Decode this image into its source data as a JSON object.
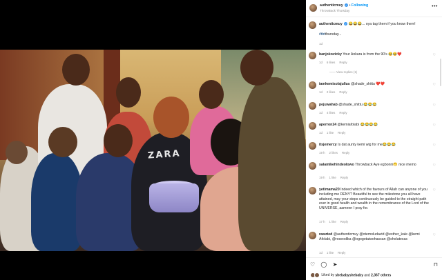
{
  "post": {
    "username": "authenticmuy",
    "follow_label": "Following",
    "subtitle": "ThrowBack Thursday",
    "caption_user": "authenticmuy",
    "caption_text": "😂😂😂... oya tag them if you know them!",
    "caption_tag": "#tbt",
    "caption_tag2": "thursday...",
    "caption_age": "1d",
    "shirt_text": "ZARA"
  },
  "comments": [
    {
      "user": "banjokovicky",
      "text": "Your Ankara is from the 90's 😂😂❤️",
      "age": "1d",
      "likes": "6 likes",
      "reply": "Reply",
      "view_replies": "View replies (1)"
    },
    {
      "user": "iamkemisolajulius",
      "text": "@shade_shittu ❤️❤️",
      "age": "1d",
      "likes": "2 likes",
      "reply": "Reply"
    },
    {
      "user": "pejuwahab",
      "text": "@shade_shittu 😂😂😂",
      "age": "1d",
      "likes": "4 likes",
      "reply": "Reply"
    },
    {
      "user": "aperron24",
      "text": "@kemiafolabi 😂😂😂😂",
      "age": "1d",
      "likes": "1 like",
      "reply": "Reply"
    },
    {
      "user": "itsjemercy",
      "text": "Is dat aunty kemi wig for me😂😂😂",
      "age": "19 h",
      "likes": "2 likes",
      "reply": "Reply"
    },
    {
      "user": "salamikehindeolowo",
      "text": "Throwback Aye egbonni😁 nice memo",
      "age": "19 h",
      "likes": "1 like",
      "reply": "Reply"
    },
    {
      "user": "yetimama20",
      "text": "Indeed which of the favours of Allah can anyone of you including me DENY? Beautiful to see the milestone you all have attained, may your steps continuously be guided to the straight path ever in good health and wealth in the remembrance of the Lord of the UNIVERSE, aameen I pray for.",
      "age": "17 h",
      "likes": "1 like",
      "reply": "Reply"
    },
    {
      "user": "rawzted",
      "text": "@authenticmuy @otemoludavid @esther_kale @kemi Afolabi, @roseodika @ogogotaiwohassan @sholatexas",
      "age": "1d",
      "likes": "1 like",
      "reply": "Reply"
    }
  ],
  "footer": {
    "liked_by_prefix": "Liked by ",
    "liked_by_user": "shebabyshebaby",
    "liked_by_and": " and ",
    "liked_by_count": "2,367 others"
  },
  "icons": [
    "heart-icon",
    "comment-icon",
    "share-icon",
    "bookmark-icon",
    "more-icon"
  ]
}
